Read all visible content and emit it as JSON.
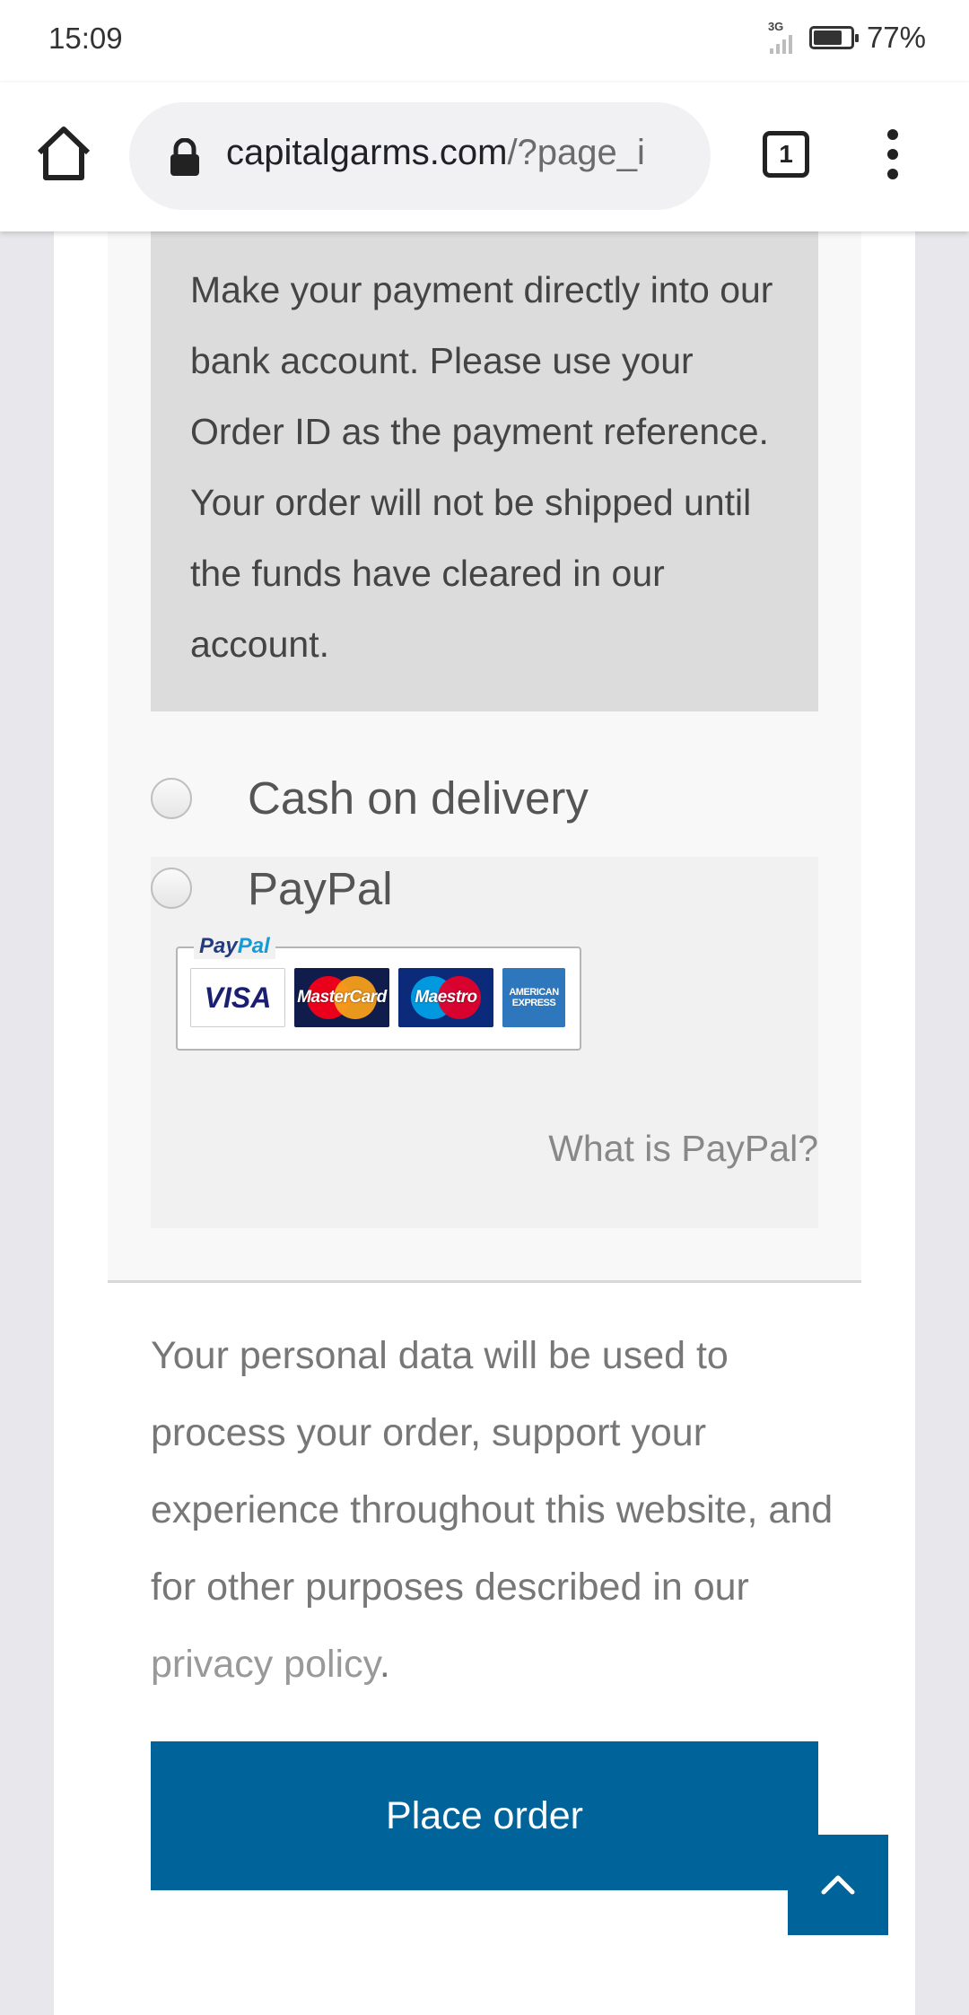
{
  "status_bar": {
    "time": "15:09",
    "network": "3G",
    "battery_percent": "77%",
    "battery_level": 0.77
  },
  "browser": {
    "url_domain": "capitalgarms.com",
    "url_path": "/?page_i",
    "tab_count": "1"
  },
  "payment": {
    "bacs_description": "Make your payment directly into our bank account. Please use your Order ID as the payment reference. Your order will not be shipped until the funds have cleared in our account.",
    "methods": [
      {
        "label": "Cash on delivery",
        "selected": false
      },
      {
        "label": "PayPal",
        "selected": false
      }
    ],
    "paypal": {
      "logo_text_pay": "Pay",
      "logo_text_pal": "Pal",
      "cards": [
        "VISA",
        "MasterCard",
        "Maestro",
        "AMERICAN EXPRESS"
      ],
      "what_is_label": "What is PayPal?"
    }
  },
  "privacy": {
    "text_before_link": "Your personal data will be used to process your order, support your experience throughout this website, and for other purposes described in our ",
    "link_text": "privacy policy",
    "text_after_link": "."
  },
  "actions": {
    "place_order_label": "Place order"
  },
  "colors": {
    "primary_button": "#00649a",
    "bacs_background": "#dddcdc",
    "page_background": "#e8e8ec"
  }
}
